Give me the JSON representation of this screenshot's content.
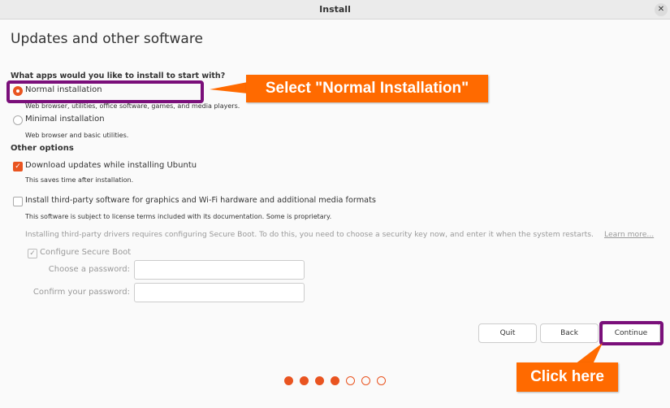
{
  "window": {
    "title": "Install",
    "close_icon": "close-icon"
  },
  "page": {
    "title": "Updates and other software"
  },
  "apps": {
    "question": "What apps would you like to install to start with?",
    "normal": {
      "label": "Normal installation",
      "desc": "Web browser, utilities, office software, games, and media players.",
      "selected": true
    },
    "minimal": {
      "label": "Minimal installation",
      "desc": "Web browser and basic utilities.",
      "selected": false
    }
  },
  "other": {
    "heading": "Other options",
    "updates": {
      "label": "Download updates while installing Ubuntu",
      "desc": "This saves time after installation.",
      "checked": true
    },
    "third_party": {
      "label": "Install third-party software for graphics and Wi-Fi hardware and additional media formats",
      "desc": "This software is subject to license terms included with its documentation. Some is proprietary.",
      "checked": false
    },
    "secure_boot_note": "Installing third-party drivers requires configuring Secure Boot. To do this, you need to choose a security key now, and enter it when the system restarts.",
    "learn_more": "Learn more...",
    "secure_boot": {
      "label": "Configure Secure Boot",
      "checked": true
    },
    "choose_password": {
      "label": "Choose a password:",
      "value": ""
    },
    "confirm_password": {
      "label": "Confirm your password:",
      "value": ""
    }
  },
  "buttons": {
    "quit": "Quit",
    "back": "Back",
    "continue": "Continue"
  },
  "progress": {
    "current_step": 4,
    "total_steps": 7
  },
  "annotations": {
    "select_callout": "Select \"Normal Installation\"",
    "click_callout": "Click here"
  },
  "colors": {
    "accent": "#e95420",
    "callout": "#ff6a00",
    "highlight": "#7a0f7a"
  }
}
